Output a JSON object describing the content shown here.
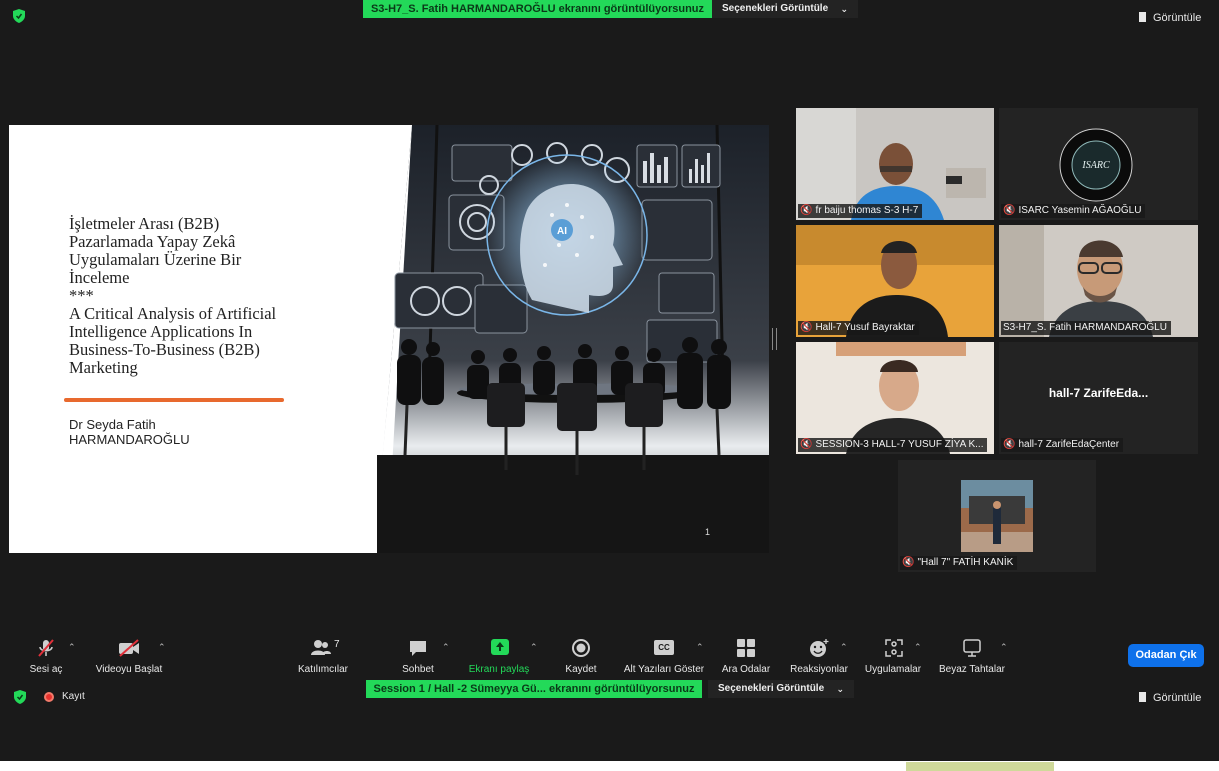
{
  "top": {
    "share_banner": "S3-H7_S. Fatih HARMANDAROĞLU ekranını görüntülüyorsunuz",
    "options_label": "Seçenekleri Görüntüle",
    "view_label": "Görüntüle"
  },
  "slide": {
    "title_lines": [
      "İşletmeler Arası (B2B)",
      "Pazarlamada Yapay Zekâ",
      "Uygulamaları Üzerine Bir",
      "İnceleme",
      "***",
      "A Critical Analysis of Artificial",
      "Intelligence Applications In",
      "Business-To-Business (B2B)",
      "Marketing"
    ],
    "author_lines": [
      "Dr Seyda Fatih",
      "HARMANDAROĞLU"
    ],
    "page_number": "1",
    "art_ai_label": "AI"
  },
  "tiles": [
    {
      "name": "fr  baiju thomas  S-3  H-7"
    },
    {
      "name": "ISARC Yasemin AĞAOĞLU",
      "logo_text": "ISARC"
    },
    {
      "name": "Hall-7 Yusuf Bayraktar"
    },
    {
      "name": "S3-H7_S. Fatih HARMANDAROĞLU"
    },
    {
      "name": "SESSION-3 HALL-7 YUSUF ZİYA K..."
    },
    {
      "name": "hall-7 ZarifeEdaÇenter",
      "big_name": "hall-7  ZarifeEda..."
    },
    {
      "name": "\"Hall 7\" FATİH KANİK"
    }
  ],
  "toolbar": {
    "mute": "Sesi aç",
    "video": "Videoyu Başlat",
    "participants": "Katılımcılar",
    "participants_count": "7",
    "chat": "Sohbet",
    "share": "Ekranı paylaş",
    "record": "Kaydet",
    "captions": "Alt Yazıları Göster",
    "captions_icon": "CC",
    "breakout": "Ara Odalar",
    "reactions": "Reaksiyonlar",
    "apps": "Uygulamalar",
    "whiteboard": "Beyaz Tahtalar",
    "leave": "Odadan Çık"
  },
  "bottom": {
    "record_status": "Kayıt",
    "share_banner": "Session 1 / Hall -2 Sümeyya Gü... ekranını görüntülüyorsunuz",
    "options_label": "Seçenekleri Görüntüle",
    "view_label": "Görüntüle"
  },
  "colors": {
    "banner_green": "#23d959",
    "leave_blue": "#0e71eb",
    "active_speaker": "#d9e86b",
    "mic_off_red": "#e0303a",
    "slide_rule_orange": "#e8692e"
  }
}
